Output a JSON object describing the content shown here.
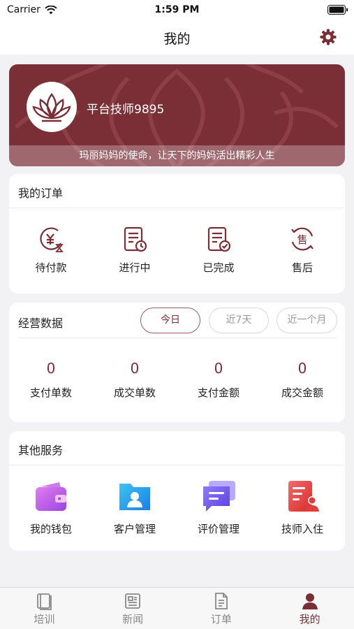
{
  "status_bar": {
    "carrier": "Carrier",
    "time": "1:59 PM"
  },
  "nav": {
    "title": "我的"
  },
  "profile": {
    "username": "平台技师9895",
    "slogan": "玛丽妈妈的使命，让天下的妈妈活出精彩人生"
  },
  "orders": {
    "title": "我的订单",
    "items": [
      {
        "label": "待付款",
        "icon": "pending-payment-icon"
      },
      {
        "label": "进行中",
        "icon": "in-progress-icon"
      },
      {
        "label": "已完成",
        "icon": "completed-icon"
      },
      {
        "label": "售后",
        "icon": "after-sales-icon"
      }
    ]
  },
  "business": {
    "title": "经营数据",
    "filters": [
      {
        "label": "今日",
        "active": true
      },
      {
        "label": "近7天",
        "active": false
      },
      {
        "label": "近一个月",
        "active": false
      }
    ],
    "stats": [
      {
        "value": "0",
        "label": "支付单数"
      },
      {
        "value": "0",
        "label": "成交单数"
      },
      {
        "value": "0",
        "label": "支付金额"
      },
      {
        "value": "0",
        "label": "成交金额"
      }
    ]
  },
  "services": {
    "title": "其他服务",
    "items": [
      {
        "label": "我的钱包",
        "icon": "wallet-icon"
      },
      {
        "label": "客户管理",
        "icon": "customer-folder-icon"
      },
      {
        "label": "评价管理",
        "icon": "review-chat-icon"
      },
      {
        "label": "技师入住",
        "icon": "technician-register-icon"
      }
    ]
  },
  "tabbar": {
    "items": [
      {
        "label": "培训",
        "icon": "book-icon",
        "active": false
      },
      {
        "label": "新闻",
        "icon": "news-icon",
        "active": false
      },
      {
        "label": "订单",
        "icon": "order-document-icon",
        "active": false
      },
      {
        "label": "我的",
        "icon": "person-icon",
        "active": true
      }
    ]
  },
  "colors": {
    "brand": "#7a2f36",
    "background": "#f2f2f4",
    "tab_inactive": "#888888"
  }
}
